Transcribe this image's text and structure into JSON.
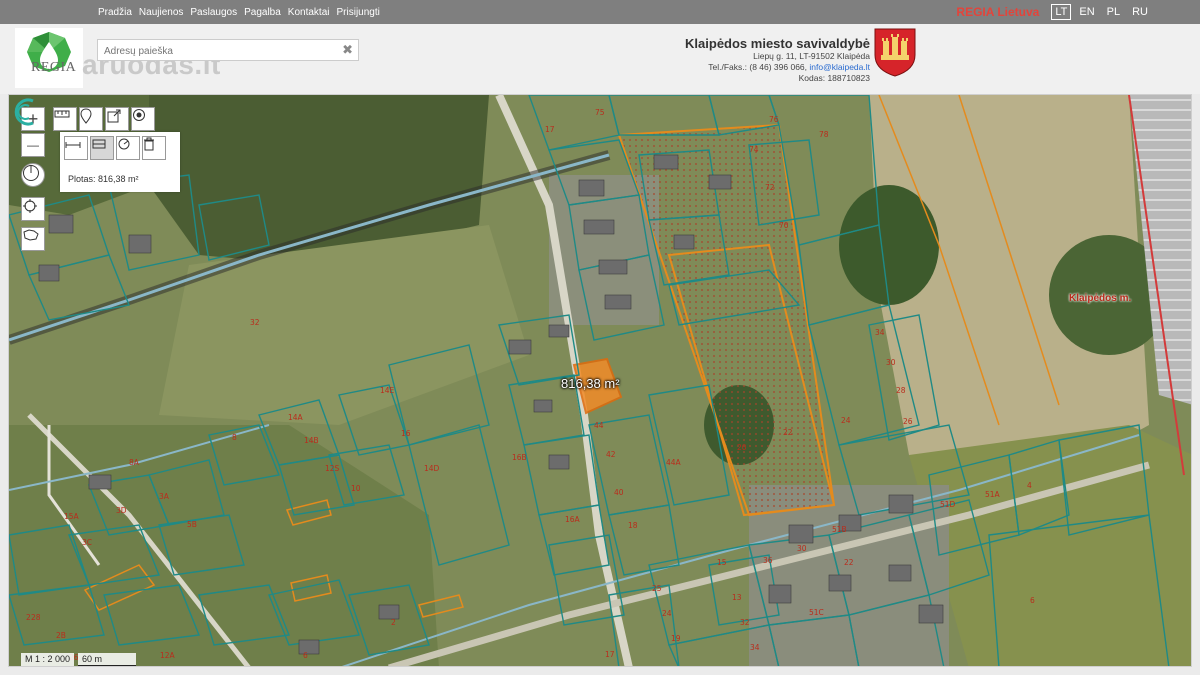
{
  "nav": {
    "items": [
      "Pradžia",
      "Naujienos",
      "Paslaugos",
      "Pagalba",
      "Kontaktai",
      "Prisijungti"
    ]
  },
  "brand": {
    "regia_label": "REGIA Lietuva",
    "languages": [
      "LT",
      "EN",
      "PL",
      "RU"
    ],
    "active_language": "LT"
  },
  "logo": {
    "text": "REGIA"
  },
  "watermark": "aruodas.lt",
  "search": {
    "placeholder": "Adresų paieška",
    "clear_symbol": "✖"
  },
  "municipality": {
    "name": "Klaipėdos miesto savivaldybė",
    "address": "Liepų g. 11, LT-91502 Klaipėda",
    "phone_label": "Tel./Faks.: (8 46) 396 066,",
    "email": "info@klaipeda.lt",
    "code": "Kodas: 188710823"
  },
  "map": {
    "measured_area_label": "Plotas: 816,38 m²",
    "measured_area_badge": "816,38 m²",
    "place_label": "Klaipėdos m.",
    "scale_ratio": "M 1 : 2 000",
    "scale_distance": "60 m",
    "parcel_labels": [
      "75",
      "17",
      "76",
      "74",
      "78",
      "72",
      "70",
      "32",
      "34",
      "30",
      "28",
      "26",
      "24",
      "22",
      "20",
      "44A",
      "44",
      "42",
      "40",
      "18",
      "16A",
      "16B",
      "16",
      "14E",
      "14D",
      "14A",
      "14B",
      "12S",
      "10",
      "8",
      "8A",
      "3A",
      "5B",
      "3D",
      "3C",
      "15A",
      "12A",
      "2B",
      "28",
      "26",
      "25",
      "24",
      "19",
      "17",
      "15",
      "13",
      "32",
      "34",
      "30",
      "36",
      "22",
      "51B",
      "51C",
      "51D",
      "51A",
      "4",
      "6",
      "2"
    ],
    "colors": {
      "parcel_outline": "#1f8a86",
      "selection_fill": "#f28c28",
      "planning_outline": "#e48b1d",
      "label_red": "#b92d1d"
    }
  },
  "tools": {
    "zoom_in": "+",
    "zoom_out": "—"
  }
}
